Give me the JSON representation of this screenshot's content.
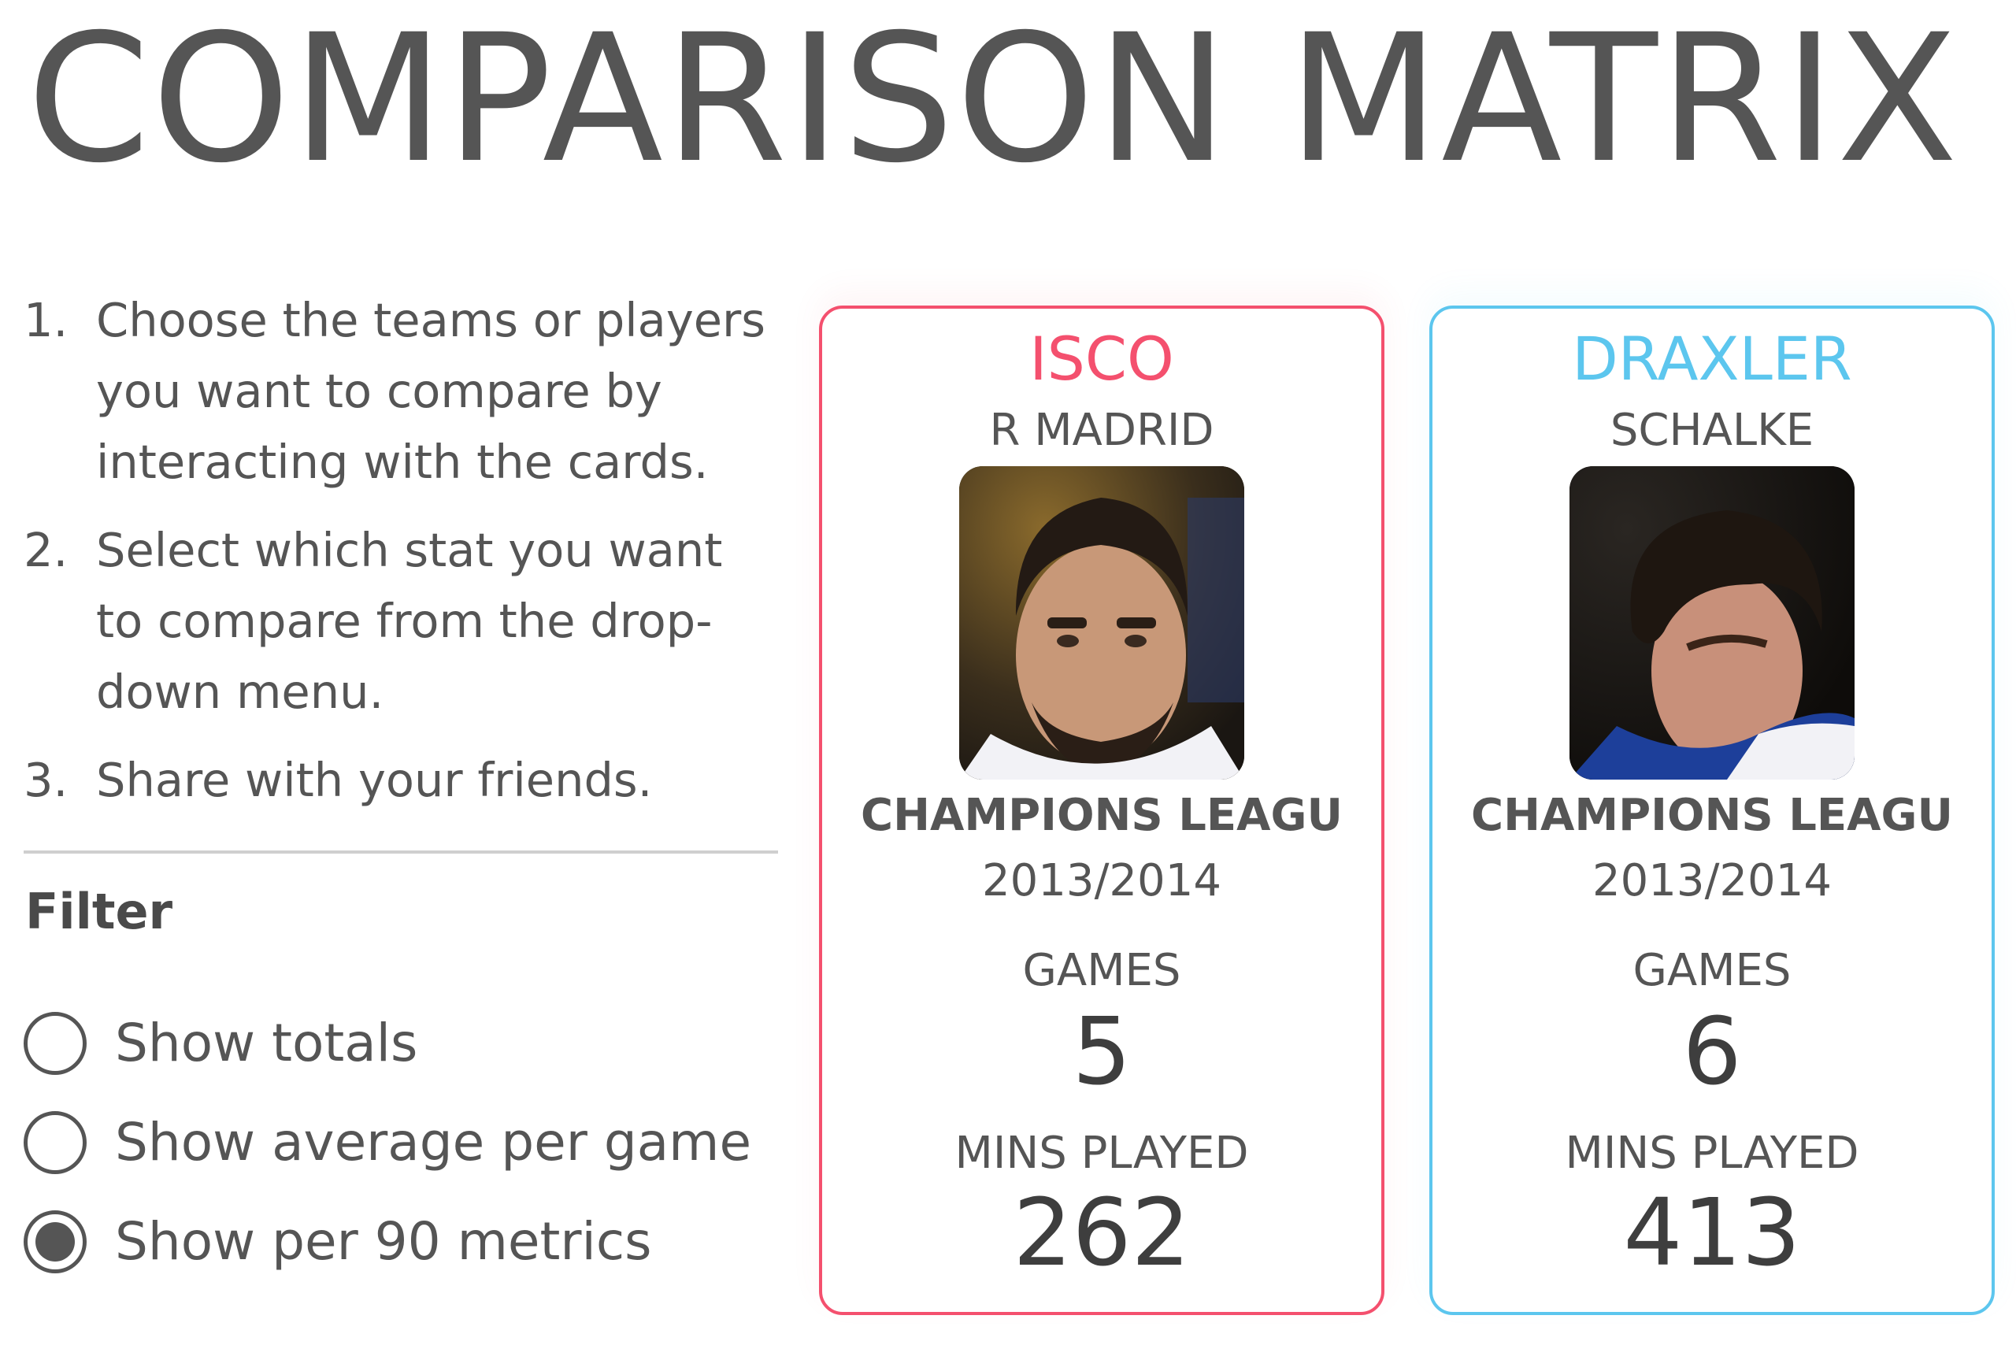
{
  "title": "COMPARISON MATRIX",
  "instructions": [
    {
      "num": "1.",
      "text": "Choose the teams or players you want to compare by interacting with the cards."
    },
    {
      "num": "2.",
      "text": "Select which stat you want to compare from the drop-down menu."
    },
    {
      "num": "3.",
      "text": "Share with your friends."
    }
  ],
  "filter": {
    "title": "Filter",
    "options": [
      {
        "label": "Show totals",
        "checked": false
      },
      {
        "label": "Show average per game",
        "checked": false
      },
      {
        "label": "Show per 90 metrics",
        "checked": true
      }
    ]
  },
  "cards": [
    {
      "player": "ISCO",
      "team": "R MADRID",
      "competition": "CHAMPIONS LEAGU",
      "season": "2013/2014",
      "games_label": "GAMES",
      "games": "5",
      "mins_label": "MINS PLAYED",
      "mins": "262",
      "accent": "#f4506e"
    },
    {
      "player": "DRAXLER",
      "team": "SCHALKE",
      "competition": "CHAMPIONS LEAGU",
      "season": "2013/2014",
      "games_label": "GAMES",
      "games": "6",
      "mins_label": "MINS PLAYED",
      "mins": "413",
      "accent": "#5cc6ee"
    }
  ]
}
